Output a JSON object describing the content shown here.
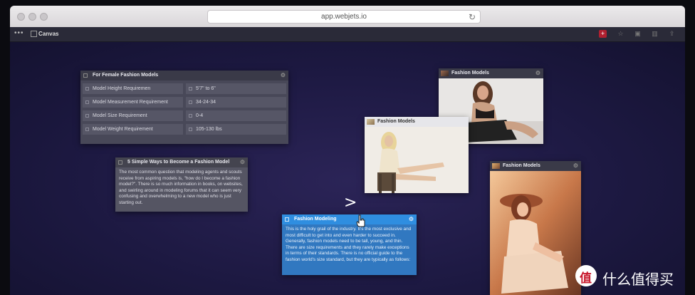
{
  "browser": {
    "url": "app.webjets.io"
  },
  "toolbar": {
    "menu_glyph": "•••",
    "canvas_label": "Canvas",
    "icons": [
      "add-icon",
      "star-icon",
      "archive-icon",
      "trash-icon",
      "share-icon"
    ]
  },
  "table_card": {
    "title": "For Female Fashion Models",
    "rows": [
      {
        "label": "Model Height Requiremen",
        "value": "5'7\" to 6\""
      },
      {
        "label": "Model Measurement Requirement",
        "value": "34-24-34"
      },
      {
        "label": "Model Size Requirement",
        "value": "0-4"
      },
      {
        "label": "Model Weight Requirement",
        "value": "105-130 lbs"
      }
    ]
  },
  "text_card": {
    "title": "5 Simple Ways to Become a Fashion Model",
    "body": "The most common question that modeling agents and scouts receive from aspiring models is, \"how do I become a fashion model?\". There is so much information in books, on websites, and swirling around in modeling forums that it can seem very confusing and overwhelming to a new model who is just starting out."
  },
  "active_card": {
    "title": "Fashion Modeling",
    "body": "This is the holy grail of the industry. It's the most exclusive and most difficult to get into and even harder to succeed in. Generally, fashion models need to be tall, young, and thin. There are size requirements and they rarely make exceptions in terms of their standards. There is no official guide to the fashion world's size standard, but they are typically as follows:"
  },
  "image_cards": [
    {
      "title": "Fashion Models"
    },
    {
      "title": "Fashion Models"
    },
    {
      "title": "Fashion Models"
    }
  ],
  "canvas_arrow": ">",
  "watermark": {
    "logo": "值",
    "text": "什么值得买"
  },
  "colors": {
    "canvas": "#1e1a3a",
    "active_header": "#2f8ee0",
    "card": "#484858"
  }
}
